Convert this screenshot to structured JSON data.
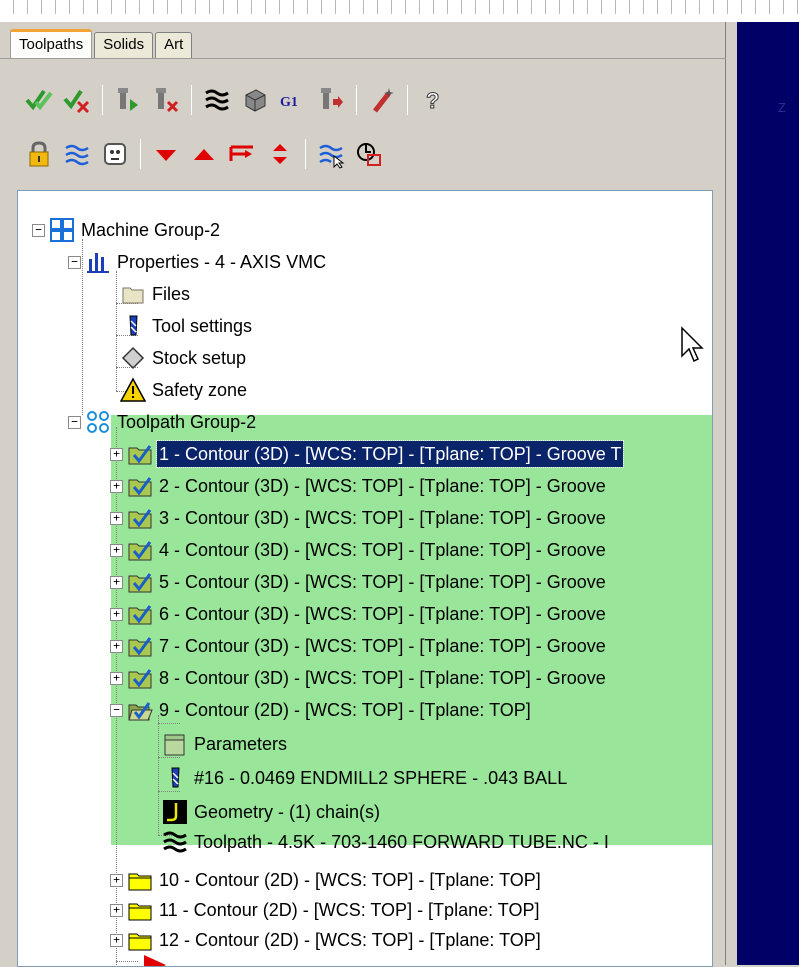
{
  "tabs": [
    {
      "label": "Toolpaths",
      "active": true
    },
    {
      "label": "Solids",
      "active": false
    },
    {
      "label": "Art",
      "active": false
    }
  ],
  "toolbar_row1": [
    "select-all-ops-icon",
    "select-dirty-ops-icon",
    "toggle-tool-display-icon",
    "toggle-tool-off-icon",
    "backplot-icon",
    "verify-icon",
    "post-g1-icon",
    "post-selected-icon",
    "magic-wand-icon",
    "help-icon"
  ],
  "toolbar_row1_g1_text": "G1",
  "toolbar_row2": [
    "lock-icon",
    "toolpath-toggle-icon",
    "hide-icon",
    "move-down-icon",
    "move-up-icon",
    "move-insert-icon",
    "expand-collapse-icon",
    "highlight-icon",
    "display-stock-icon"
  ],
  "help_glyph": "?",
  "tree": {
    "machine_group": "Machine Group-2",
    "properties": "Properties - 4 - AXIS VMC",
    "properties_children": [
      "Files",
      "Tool settings",
      "Stock setup",
      "Safety zone"
    ],
    "toolpath_group": "Toolpath Group-2",
    "operations": [
      "1 - Contour (3D) - [WCS: TOP] - [Tplane: TOP] - Groove T",
      "2 - Contour (3D) - [WCS: TOP] - [Tplane: TOP] - Groove",
      "3 - Contour (3D) - [WCS: TOP] - [Tplane: TOP] - Groove",
      "4 - Contour (3D) - [WCS: TOP] - [Tplane: TOP] - Groove",
      "5 - Contour (3D) - [WCS: TOP] - [Tplane: TOP] - Groove",
      "6 - Contour (3D) - [WCS: TOP] - [Tplane: TOP] - Groove",
      "7 - Contour (3D) - [WCS: TOP] - [Tplane: TOP] - Groove",
      "8 - Contour (3D) - [WCS: TOP] - [Tplane: TOP] - Groove",
      "9 - Contour (2D) - [WCS: TOP] - [Tplane: TOP]"
    ],
    "op9_children": [
      "Parameters",
      "#16 - 0.0469 ENDMILL2 SPHERE - .043 BALL",
      "Geometry - (1) chain(s)",
      "Toolpath - 4.5K - 703-1460 FORWARD TUBE.NC - I"
    ],
    "other_ops": [
      "10 - Contour (2D) - [WCS: TOP] - [Tplane: TOP]",
      "11 - Contour (2D) - [WCS: TOP] - [Tplane: TOP]",
      "12 - Contour (2D) - [WCS: TOP] - [Tplane: TOP]"
    ],
    "selected_index": 0
  },
  "viewport_label": "Z",
  "colors": {
    "selection_highlight": "#99e69a",
    "selected_row": "#0a246a",
    "viewport_bg": "#000066",
    "tab_accent": "#f2a333"
  }
}
